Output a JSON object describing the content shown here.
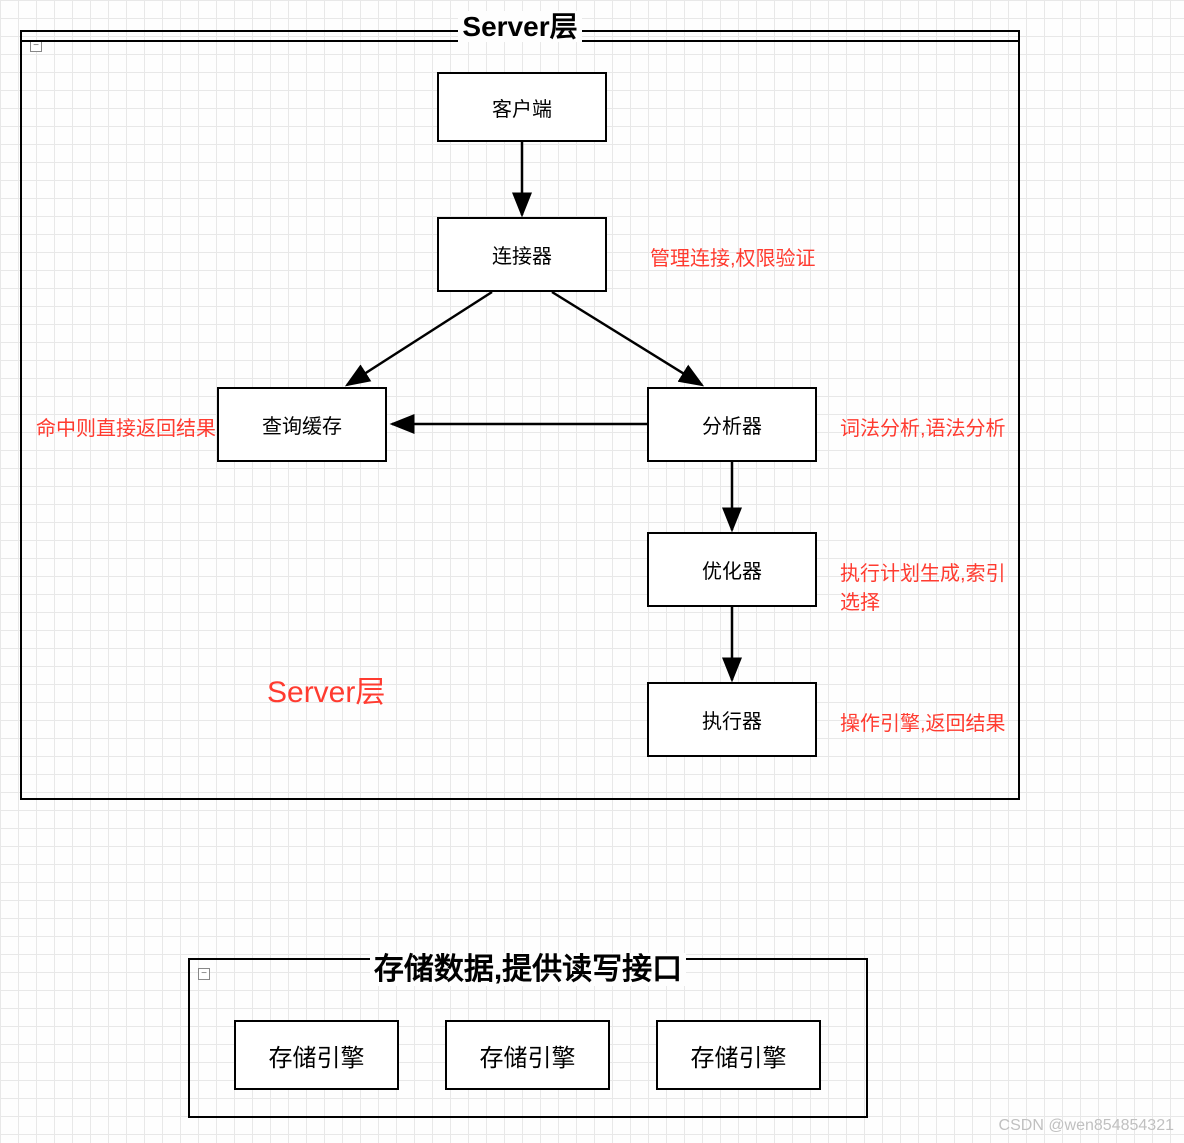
{
  "server": {
    "title": "Server层",
    "collapse": "−",
    "big_label": "Server层",
    "nodes": {
      "client": "客户端",
      "connector": "连接器",
      "cache": "查询缓存",
      "analyzer": "分析器",
      "optimizer": "优化器",
      "executor": "执行器"
    },
    "annotations": {
      "connector_note": "管理连接,权限验证",
      "cache_note": "命中则直接返回结果",
      "analyzer_note": "词法分析,语法分析",
      "optimizer_note": "执行计划生成,索引选择",
      "executor_note": "操作引擎,返回结果"
    }
  },
  "storage": {
    "title": "存储数据,提供读写接口",
    "collapse": "−",
    "nodes": {
      "engine1": "存储引擎",
      "engine2": "存储引擎",
      "engine3": "存储引擎"
    }
  },
  "watermark": "CSDN @wen854854321"
}
